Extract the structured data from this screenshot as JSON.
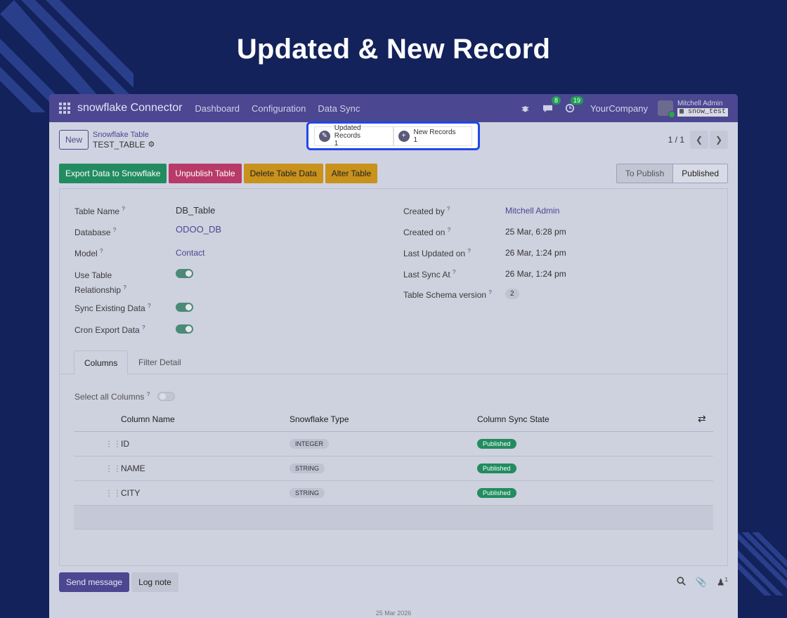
{
  "headline": "Updated & New Record",
  "navbar": {
    "brand": "snowflake Connector",
    "links": [
      "Dashboard",
      "Configuration",
      "Data Sync"
    ],
    "messages_badge": "8",
    "activities_badge": "19",
    "company": "YourCompany",
    "user_name": "Mitchell Admin",
    "db_name": "snow_test"
  },
  "control": {
    "new_label": "New",
    "breadcrumb_parent": "Snowflake Table",
    "breadcrumb_current": "TEST_TABLE",
    "smart_buttons": [
      {
        "label": "Updated Records",
        "count": "1"
      },
      {
        "label": "New Records",
        "count": "1"
      }
    ],
    "pager": "1 / 1"
  },
  "actions": {
    "export": "Export Data to Snowflake",
    "unpublish": "Unpublish Table",
    "delete": "Delete Table Data",
    "alter": "Alter Table"
  },
  "stages": {
    "inactive": "To Publish",
    "active": "Published"
  },
  "form": {
    "table_name_label": "Table Name",
    "table_name": "DB_Table",
    "database_label": "Database",
    "database": "ODOO_DB",
    "model_label": "Model",
    "model": "Contact",
    "use_rel_label_1": "Use Table",
    "use_rel_label_2": "Relationship",
    "sync_existing_label": "Sync Existing Data",
    "cron_label": "Cron Export Data",
    "created_by_label": "Created by",
    "created_by": "Mitchell Admin",
    "created_on_label": "Created on",
    "created_on": "25 Mar, 6:28 pm",
    "last_updated_label": "Last Updated on",
    "last_updated": "26 Mar, 1:24 pm",
    "last_sync_label": "Last Sync At",
    "last_sync": "26 Mar, 1:24 pm",
    "schema_label": "Table Schema version",
    "schema_version": "2"
  },
  "tabs": {
    "columns": "Columns",
    "filter": "Filter Detail"
  },
  "columns_grid": {
    "select_all_label": "Select all Columns",
    "headers": [
      "Column Name",
      "Snowflake Type",
      "Column Sync State"
    ],
    "rows": [
      {
        "name": "ID",
        "type": "INTEGER",
        "state": "Published"
      },
      {
        "name": "NAME",
        "type": "STRING",
        "state": "Published"
      },
      {
        "name": "CITY",
        "type": "STRING",
        "state": "Published"
      }
    ]
  },
  "chatter": {
    "send_message": "Send message",
    "log_note": "Log note",
    "followers_count": "1",
    "date_separator": "25 Mar 2026"
  },
  "colors": {
    "background": "#13225a",
    "navbar": "#4b4791",
    "highlight_border": "#2149e8",
    "published_chip": "#228c60"
  }
}
